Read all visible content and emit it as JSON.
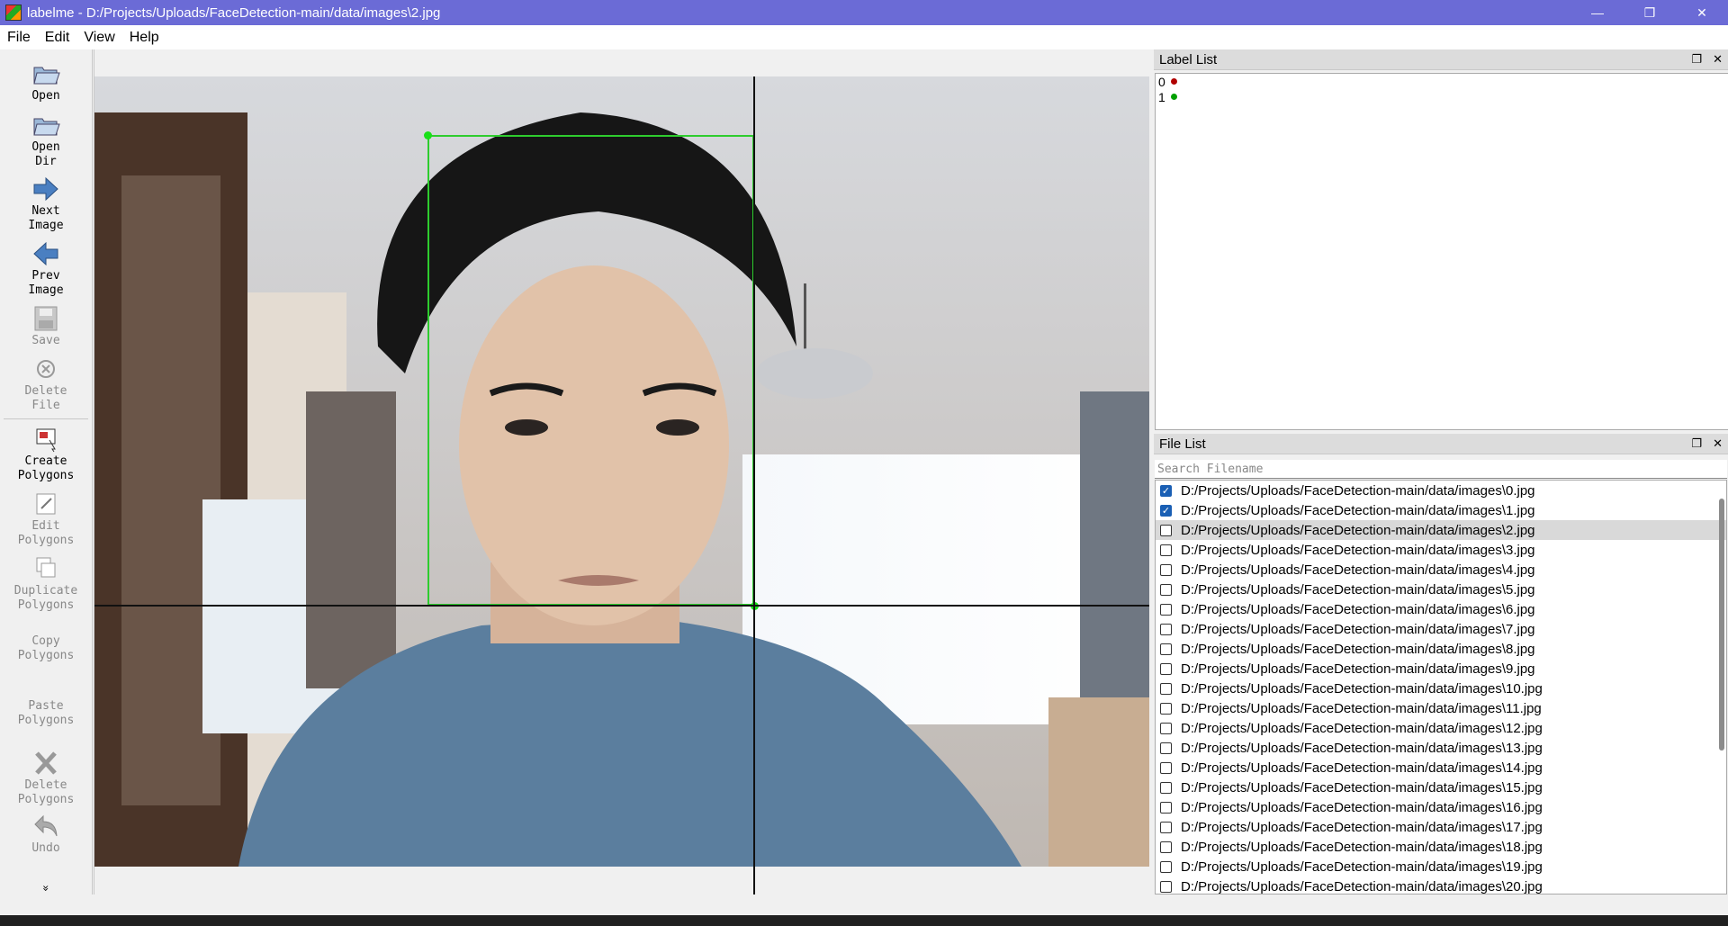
{
  "window": {
    "title": "labelme - D:/Projects/Uploads/FaceDetection-main/data/images\\2.jpg",
    "min": "—",
    "max": "❐",
    "close": "✕"
  },
  "menu": [
    "File",
    "Edit",
    "View",
    "Help"
  ],
  "toolbar": {
    "open": "Open",
    "open_dir": "Open\nDir",
    "next": "Next\nImage",
    "prev": "Prev\nImage",
    "save": "Save",
    "delete_file": "Delete\nFile",
    "create": "Create\nPolygons",
    "edit": "Edit\nPolygons",
    "duplicate": "Duplicate\nPolygons",
    "copy": "Copy\nPolygons",
    "paste": "Paste\nPolygons",
    "delete_poly": "Delete\nPolygons",
    "undo": "Undo",
    "more": "»"
  },
  "label_list": {
    "title": "Label List",
    "items": [
      {
        "label": "0",
        "color": "#b00000"
      },
      {
        "label": "1",
        "color": "#00a000"
      }
    ]
  },
  "file_list": {
    "title": "File List",
    "search_placeholder": "Search Filename",
    "files": [
      {
        "path": "D:/Projects/Uploads/FaceDetection-main/data/images\\0.jpg",
        "checked": true,
        "selected": false
      },
      {
        "path": "D:/Projects/Uploads/FaceDetection-main/data/images\\1.jpg",
        "checked": true,
        "selected": false
      },
      {
        "path": "D:/Projects/Uploads/FaceDetection-main/data/images\\2.jpg",
        "checked": false,
        "selected": true
      },
      {
        "path": "D:/Projects/Uploads/FaceDetection-main/data/images\\3.jpg",
        "checked": false,
        "selected": false
      },
      {
        "path": "D:/Projects/Uploads/FaceDetection-main/data/images\\4.jpg",
        "checked": false,
        "selected": false
      },
      {
        "path": "D:/Projects/Uploads/FaceDetection-main/data/images\\5.jpg",
        "checked": false,
        "selected": false
      },
      {
        "path": "D:/Projects/Uploads/FaceDetection-main/data/images\\6.jpg",
        "checked": false,
        "selected": false
      },
      {
        "path": "D:/Projects/Uploads/FaceDetection-main/data/images\\7.jpg",
        "checked": false,
        "selected": false
      },
      {
        "path": "D:/Projects/Uploads/FaceDetection-main/data/images\\8.jpg",
        "checked": false,
        "selected": false
      },
      {
        "path": "D:/Projects/Uploads/FaceDetection-main/data/images\\9.jpg",
        "checked": false,
        "selected": false
      },
      {
        "path": "D:/Projects/Uploads/FaceDetection-main/data/images\\10.jpg",
        "checked": false,
        "selected": false
      },
      {
        "path": "D:/Projects/Uploads/FaceDetection-main/data/images\\11.jpg",
        "checked": false,
        "selected": false
      },
      {
        "path": "D:/Projects/Uploads/FaceDetection-main/data/images\\12.jpg",
        "checked": false,
        "selected": false
      },
      {
        "path": "D:/Projects/Uploads/FaceDetection-main/data/images\\13.jpg",
        "checked": false,
        "selected": false
      },
      {
        "path": "D:/Projects/Uploads/FaceDetection-main/data/images\\14.jpg",
        "checked": false,
        "selected": false
      },
      {
        "path": "D:/Projects/Uploads/FaceDetection-main/data/images\\15.jpg",
        "checked": false,
        "selected": false
      },
      {
        "path": "D:/Projects/Uploads/FaceDetection-main/data/images\\16.jpg",
        "checked": false,
        "selected": false
      },
      {
        "path": "D:/Projects/Uploads/FaceDetection-main/data/images\\17.jpg",
        "checked": false,
        "selected": false
      },
      {
        "path": "D:/Projects/Uploads/FaceDetection-main/data/images\\18.jpg",
        "checked": false,
        "selected": false
      },
      {
        "path": "D:/Projects/Uploads/FaceDetection-main/data/images\\19.jpg",
        "checked": false,
        "selected": false
      },
      {
        "path": "D:/Projects/Uploads/FaceDetection-main/data/images\\20.jpg",
        "checked": false,
        "selected": false
      }
    ]
  },
  "colors": {
    "titlebar": "#6b6bd6",
    "bbox": "#2ecc2e",
    "checkbox_on": "#1a5fb4"
  }
}
